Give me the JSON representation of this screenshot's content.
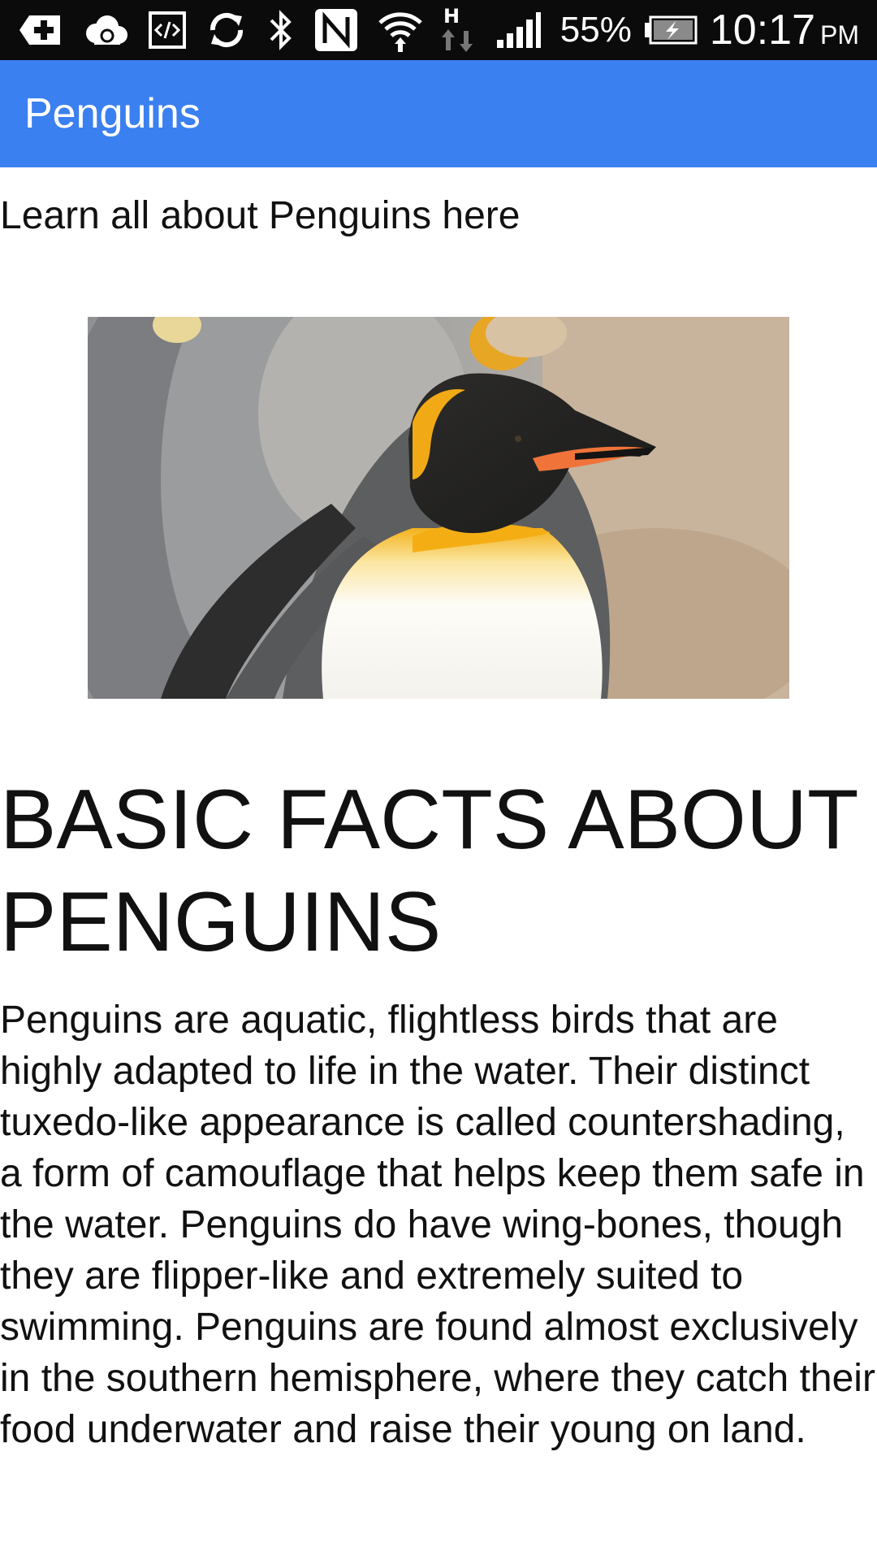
{
  "status_bar": {
    "icons": [
      "add-notification-icon",
      "cloud-sync-icon",
      "code-icon",
      "sync-icon",
      "bluetooth-icon",
      "nfc-icon",
      "wifi-icon",
      "data-h-icon",
      "signal-icon",
      "battery-charging-icon"
    ],
    "data_label": "H",
    "battery_percent": "55%",
    "time": "10:17",
    "time_suffix": "PM"
  },
  "app_bar": {
    "title": "Penguins",
    "color": "#3b80f0"
  },
  "page": {
    "intro": "Learn all about Penguins here",
    "hero_image": "penguin-photo",
    "heading": "BASIC FACTS ABOUT PENGUINS",
    "body": "Penguins are aquatic, flightless birds that are highly adapted to life in the water. Their distinct tuxedo-like appearance is called countershading, a form of camouflage that helps keep them safe in the water. Penguins do have wing-bones, though they are flipper-like and extremely suited to swimming. Penguins are found almost exclusively in the southern hemisphere, where they catch their food underwater and raise their young on land."
  }
}
